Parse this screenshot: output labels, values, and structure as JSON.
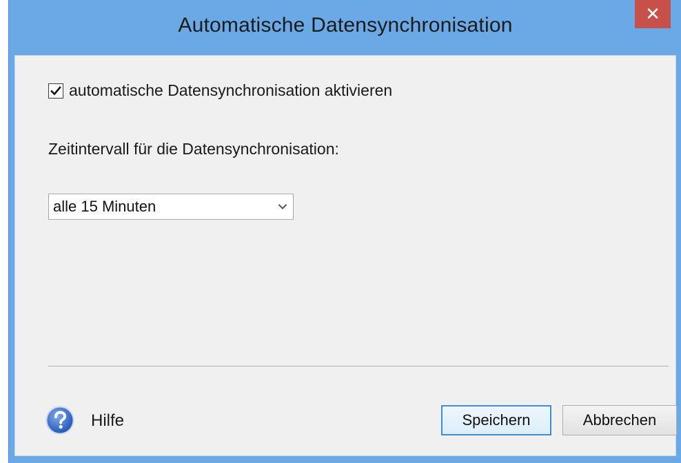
{
  "window": {
    "title": "Automatische Datensynchronisation",
    "close_glyph": "✕"
  },
  "sync": {
    "checkbox_label": "automatische Datensynchronisation aktivieren",
    "checked": true,
    "interval_label": "Zeitintervall für die Datensynchronisation:",
    "interval_selected": "alle 15 Minuten"
  },
  "footer": {
    "help_label": "Hilfe",
    "save_label": "Speichern",
    "cancel_label": "Abbrechen"
  },
  "icons": {
    "help": "help-question-icon",
    "check": "checkmark-icon",
    "dropdown": "chevron-down-icon",
    "close": "close-icon"
  },
  "colors": {
    "frame": "#6aa9e6",
    "close_button": "#c7504a",
    "client_background": "#f0f0f0",
    "default_button_border": "#3c8fd6"
  }
}
